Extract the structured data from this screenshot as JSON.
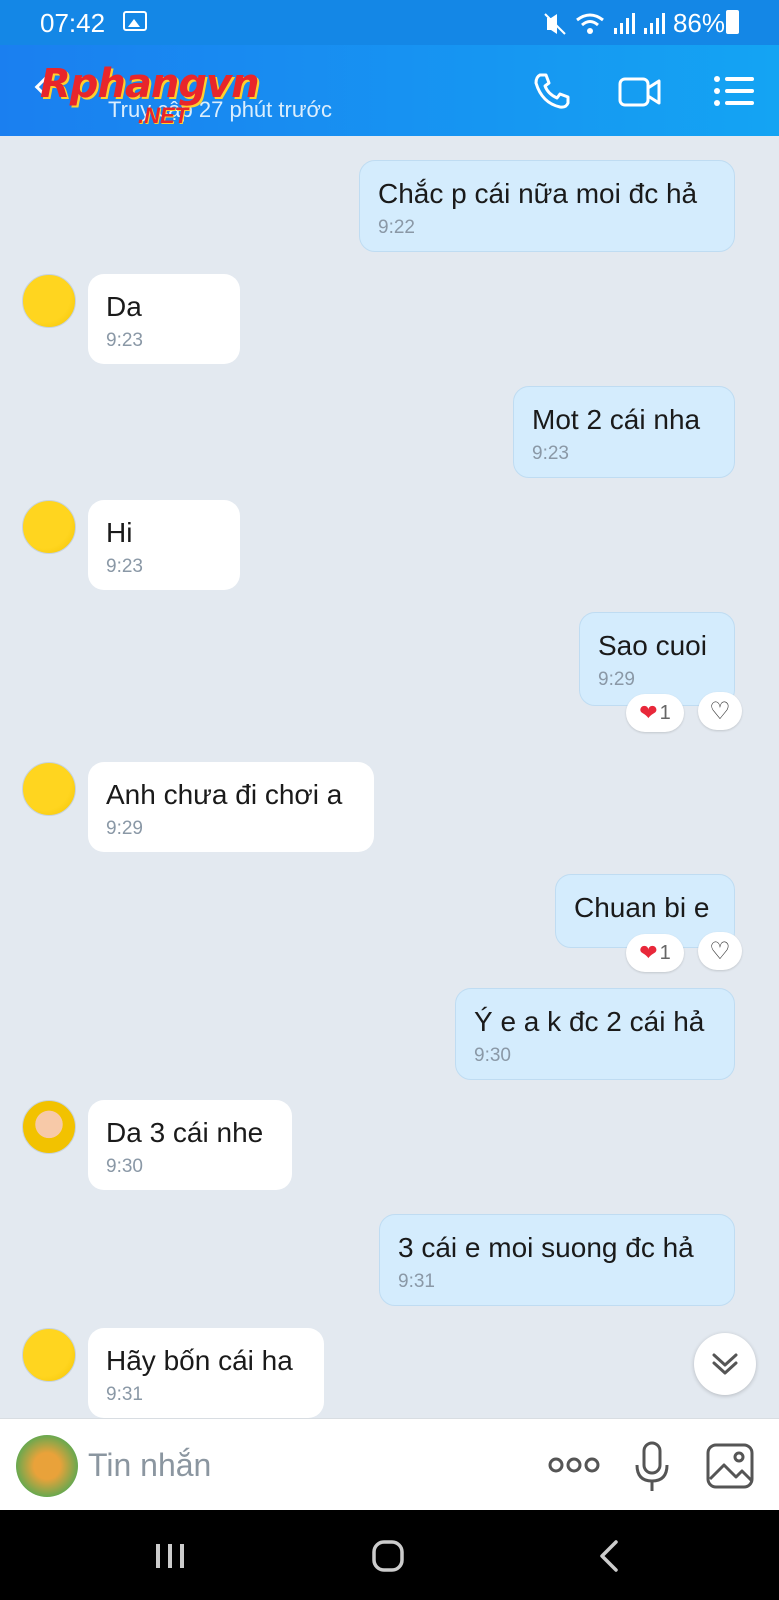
{
  "status_bar": {
    "time": "07:42",
    "battery": "86%"
  },
  "header": {
    "logo": "Rphangvn",
    "logo_sub": ".NET",
    "subtitle": "Truy cập 27 phút trước"
  },
  "messages": [
    {
      "dir": "out",
      "text": "Chắc p cái nữa moi đc hả",
      "time": "9:22"
    },
    {
      "dir": "in",
      "text": "Da",
      "time": "9:23"
    },
    {
      "dir": "out",
      "text": "Mot 2 cái nha",
      "time": "9:23"
    },
    {
      "dir": "in",
      "text": "Hi",
      "time": "9:23"
    },
    {
      "dir": "out",
      "text": "Sao cuoi",
      "time": "9:29",
      "reaction_count": "1"
    },
    {
      "dir": "in",
      "text": "Anh chưa đi chơi a",
      "time": "9:29"
    },
    {
      "dir": "out",
      "text": "Chuan bi e",
      "time": "",
      "reaction_count": "1"
    },
    {
      "dir": "out",
      "text": "Ý e a k đc 2 cái hả",
      "time": "9:30"
    },
    {
      "dir": "in",
      "text": "Da 3 cái nhe",
      "time": "9:30"
    },
    {
      "dir": "out",
      "text": "3 cái e moi suong đc hả",
      "time": "9:31"
    },
    {
      "dir": "in",
      "text": "Hãy bốn cái ha",
      "time": "9:31"
    }
  ],
  "input": {
    "placeholder": "Tin nhắn"
  },
  "colors": {
    "header": "#1a7ff0",
    "outgoing_bubble": "#d4ecfd",
    "incoming_bubble": "#ffffff",
    "background": "#e3e9f0"
  },
  "icons": [
    "image-icon",
    "mute-icon",
    "wifi-icon",
    "signal-icon",
    "battery-icon",
    "back-icon",
    "phone-icon",
    "video-call-icon",
    "menu-list-icon",
    "heart-icon",
    "heart-outline-icon",
    "double-chevron-down-icon",
    "sticker-icon",
    "more-dots-icon",
    "microphone-icon",
    "gallery-icon",
    "recent-apps-icon",
    "home-icon",
    "nav-back-icon"
  ]
}
